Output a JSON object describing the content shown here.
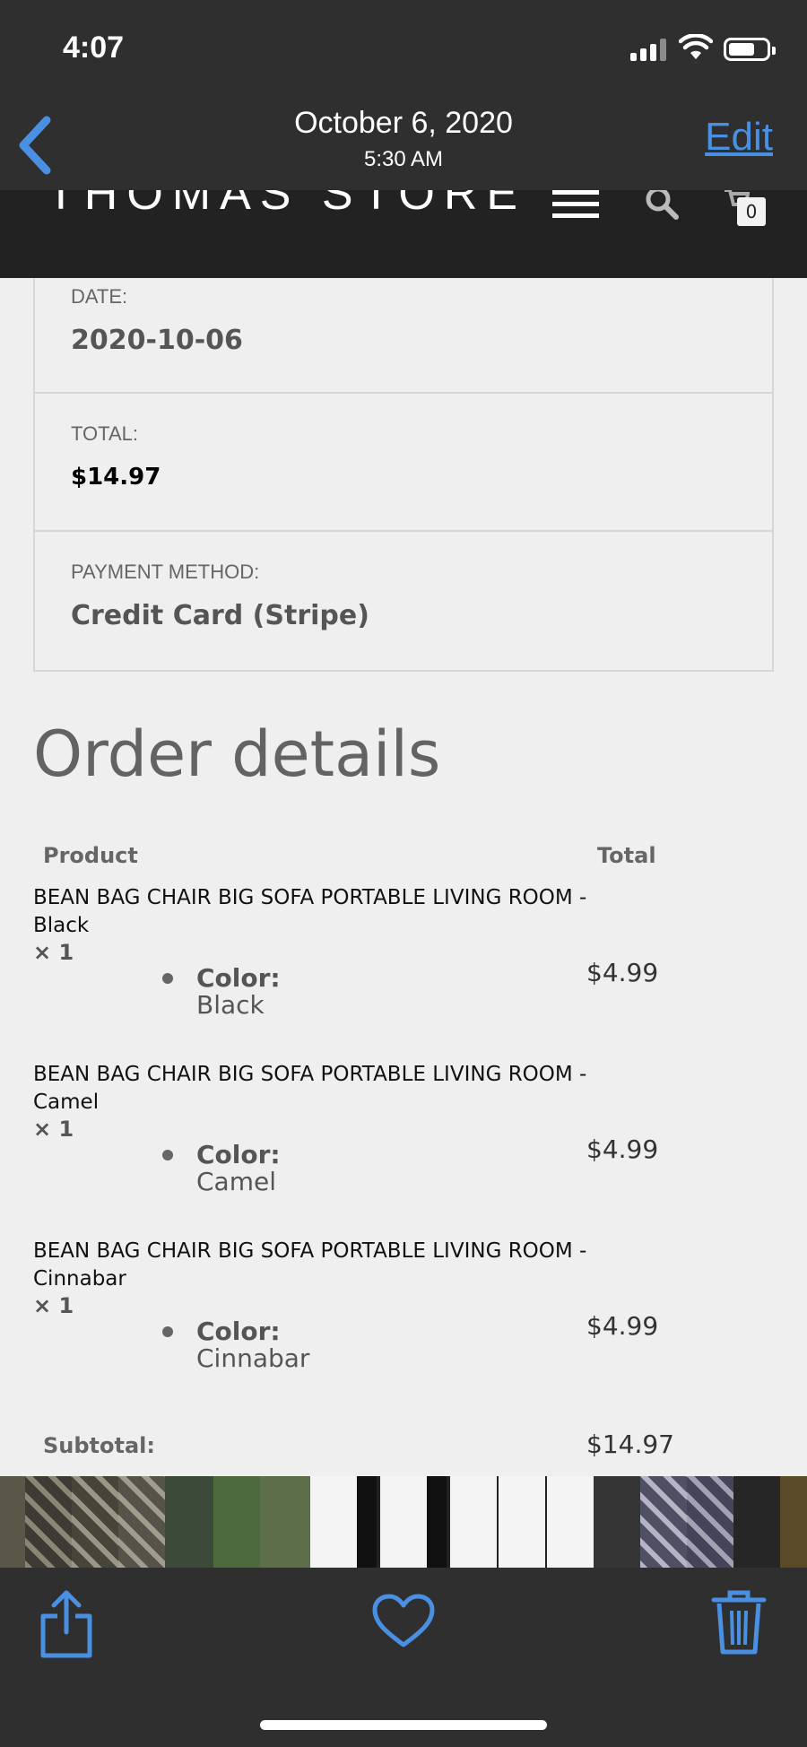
{
  "status": {
    "time": "4:07"
  },
  "photo_header": {
    "date": "October 6, 2020",
    "time": "5:30 AM",
    "edit_label": "Edit"
  },
  "store": {
    "name": "THOMAS STORE",
    "cart_count": "0"
  },
  "overview": {
    "date_label": "DATE:",
    "date_value": "2020-10-06",
    "total_label": "TOTAL:",
    "total_value": "$14.97",
    "payment_label": "PAYMENT METHOD:",
    "payment_value": "Credit Card (Stripe)"
  },
  "order_details": {
    "title": "Order details",
    "columns": [
      "Product",
      "Total"
    ],
    "items": [
      {
        "name": "BEAN BAG CHAIR BIG SOFA PORTABLE LIVING ROOM - Black",
        "qty": "× 1",
        "meta_key": "Color:",
        "meta_value": "Black",
        "total": "$4.99"
      },
      {
        "name": "BEAN BAG CHAIR BIG SOFA PORTABLE LIVING ROOM - Camel",
        "qty": "× 1",
        "meta_key": "Color:",
        "meta_value": "Camel",
        "total": "$4.99"
      },
      {
        "name": "BEAN BAG CHAIR BIG SOFA PORTABLE LIVING ROOM - Cinnabar",
        "qty": "× 1",
        "meta_key": "Color:",
        "meta_value": "Cinnabar",
        "total": "$4.99"
      }
    ],
    "subtotal_label": "Subtotal:",
    "subtotal_value": "$14.97"
  },
  "icons": {
    "back": "chevron-left-icon",
    "menu": "hamburger-menu-icon",
    "search": "search-icon",
    "cart": "cart-icon",
    "share": "share-icon",
    "favorite": "heart-icon",
    "delete": "trash-icon"
  },
  "colors": {
    "accent": "#4a90e2",
    "chrome": "#2f2f2f",
    "store_bar": "#222222",
    "page_bg": "#efefef"
  }
}
